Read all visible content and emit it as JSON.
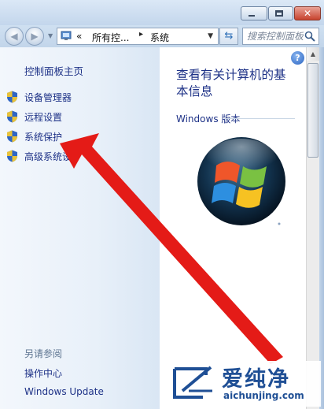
{
  "window": {
    "minimize_glyph": "",
    "close_glyph": "✕"
  },
  "nav": {
    "back_glyph": "◀",
    "forward_glyph": "▶",
    "address_prefix": "«",
    "breadcrumb_1": "所有控...",
    "breadcrumb_sep": "▸",
    "breadcrumb_2": "系统",
    "search_placeholder": "搜索控制面板"
  },
  "left_pane": {
    "home": "控制面板主页",
    "tasks": [
      {
        "label": "设备管理器"
      },
      {
        "label": "远程设置"
      },
      {
        "label": "系统保护"
      },
      {
        "label": "高级系统设"
      }
    ],
    "see_also": "另请参阅",
    "links": [
      "操作中心",
      "Windows Update"
    ]
  },
  "right_pane": {
    "title": "查看有关计算机的基本信息",
    "edition_heading": "Windows 版本",
    "help_glyph": "?"
  },
  "watermark": {
    "mark_text": "爱纯净",
    "url": "aichunjing.com"
  },
  "colors": {
    "link": "#1e3287",
    "arrow": "#e41b17",
    "watermark": "#1f4f95"
  }
}
